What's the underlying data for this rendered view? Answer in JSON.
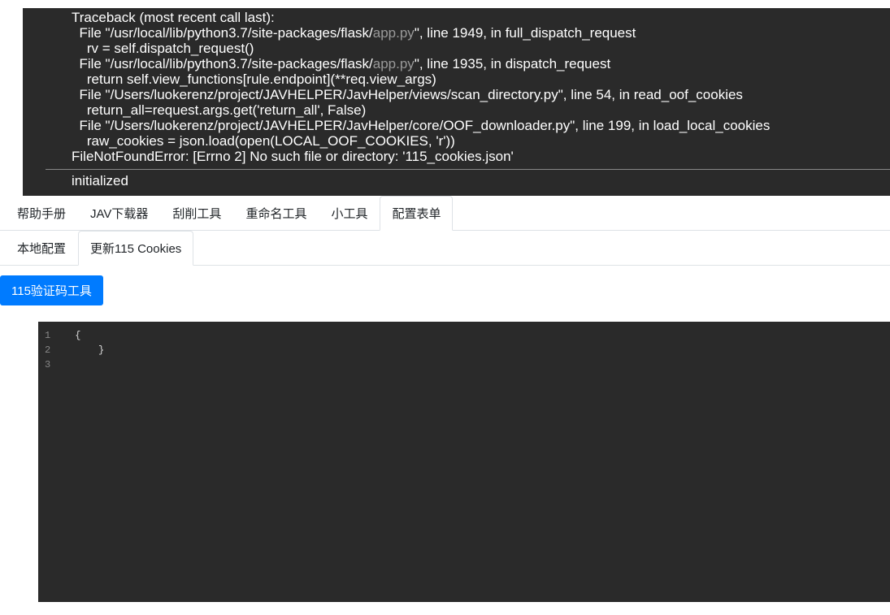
{
  "console": {
    "traceback_header": "Traceback (most recent call last):",
    "frames": [
      {
        "file_prefix": "  File \"/usr/local/lib/python3.7/site-packages/flask/",
        "file_dim": "app.py",
        "file_suffix": "\", line 1949, in full_dispatch_request",
        "code": "    rv = self.dispatch_request()"
      },
      {
        "file_prefix": "  File \"/usr/local/lib/python3.7/site-packages/flask/",
        "file_dim": "app.py",
        "file_suffix": "\", line 1935, in dispatch_request",
        "code": "    return self.view_functions[rule.endpoint](**req.view_args)"
      },
      {
        "file_prefix": "  File \"/Users/luokerenz/project/JAVHELPER/JavHelper/views/scan_directory.py\", line 54, in read_oof_cookies",
        "file_dim": "",
        "file_suffix": "",
        "code": "    return_all=request.args.get('return_all', False)"
      },
      {
        "file_prefix": "  File \"/Users/luokerenz/project/JAVHELPER/JavHelper/core/OOF_downloader.py\", line 199, in load_local_cookies",
        "file_dim": "",
        "file_suffix": "",
        "code": "    raw_cookies = json.load(open(LOCAL_OOF_COOKIES, 'r'))"
      }
    ],
    "error_line": "FileNotFoundError: [Errno 2] No such file or directory: '115_cookies.json'",
    "log_message": "initialized"
  },
  "main_tabs": [
    {
      "label": "帮助手册",
      "active": false
    },
    {
      "label": "JAV下载器",
      "active": false
    },
    {
      "label": "刮削工具",
      "active": false
    },
    {
      "label": "重命名工具",
      "active": false
    },
    {
      "label": "小工具",
      "active": false
    },
    {
      "label": "配置表单",
      "active": true
    }
  ],
  "sub_tabs": [
    {
      "label": "本地配置",
      "active": false
    },
    {
      "label": "更新115 Cookies",
      "active": true
    }
  ],
  "verification_button": "115验证码工具",
  "editor": {
    "lines": [
      {
        "num": "1",
        "content": "{"
      },
      {
        "num": "2",
        "content": "    }"
      },
      {
        "num": "3",
        "content": ""
      }
    ]
  }
}
